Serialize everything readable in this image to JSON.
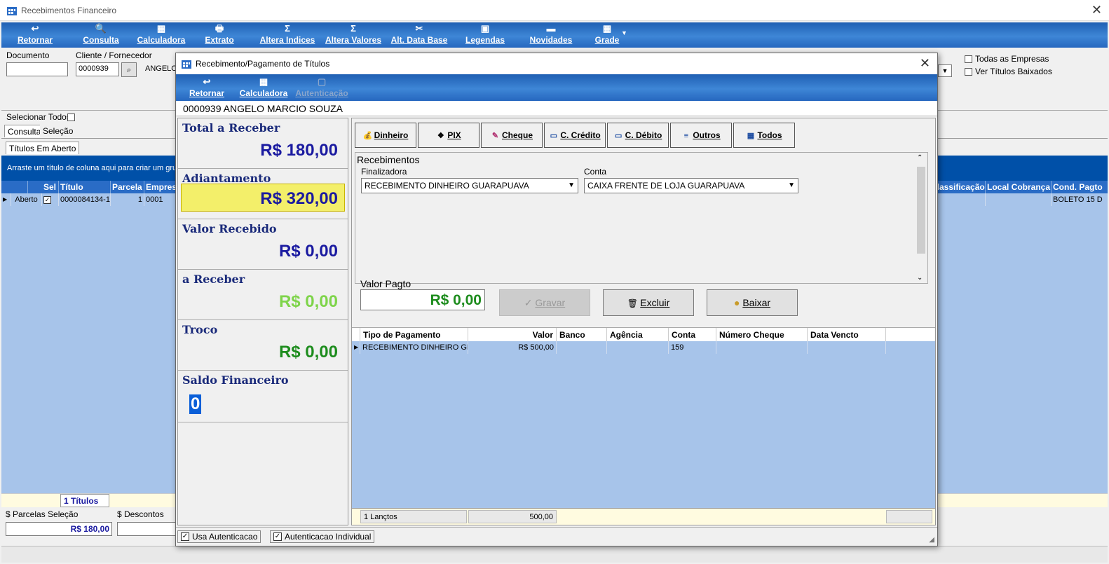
{
  "window": {
    "title": "Recebimentos Financeiro",
    "close_glyph": "✕"
  },
  "main_toolbar": [
    {
      "id": "retornar",
      "label": "Retornar",
      "icon": "return-icon",
      "glyph": "↩"
    },
    {
      "id": "consulta",
      "label": "Consulta",
      "icon": "search-icon",
      "glyph": "🔍"
    },
    {
      "id": "calculadora",
      "label": "Calculadora",
      "icon": "calculator-icon",
      "glyph": "▦"
    },
    {
      "id": "extrato",
      "label": "Extrato",
      "icon": "printer-icon",
      "glyph": "🖶"
    },
    {
      "id": "altera_indices",
      "label": "Altera Indices",
      "icon": "sigma-icon",
      "glyph": "Σ"
    },
    {
      "id": "altera_valores",
      "label": "Altera Valores",
      "icon": "sigma-icon",
      "glyph": "Σ"
    },
    {
      "id": "alt_data_base",
      "label": "Alt. Data Base",
      "icon": "tools-icon",
      "glyph": "✂"
    },
    {
      "id": "legendas",
      "label": "Legendas",
      "icon": "legend-icon",
      "glyph": "▣"
    },
    {
      "id": "novidades",
      "label": "Novidades",
      "icon": "news-icon",
      "glyph": "▬"
    },
    {
      "id": "grade",
      "label": "Grade",
      "icon": "grid-icon",
      "glyph": "▦"
    }
  ],
  "filter": {
    "documento_label": "Documento",
    "documento_value": "",
    "cliente_label": "Cliente / Fornecedor",
    "cliente_code": "0000939",
    "cliente_name": "ANGELO",
    "todas_empresas": "Todas as Empresas",
    "ver_baixados": "Ver Títulos Baixados",
    "selecionar_todos": "Selecionar Todos"
  },
  "tabs": {
    "consulta": "Consulta",
    "selecao": "Seleção",
    "titulos_aberto": "Títulos Em Aberto"
  },
  "group_hint": "Arraste um título de coluna aqui para criar um grupo",
  "main_grid": {
    "headers": [
      "Sel",
      "Título",
      "Parcela",
      "Empres",
      "Classificação",
      "Local Cobrança",
      "Cond. Pagto"
    ],
    "row": {
      "status": "Aberto",
      "titulo": "0000084134-1",
      "parcela": "1",
      "empresa": "0001",
      "cond": "BOLETO 15 D"
    },
    "footer_count": "1 Títulos"
  },
  "bottom": {
    "parcelas_label": "$ Parcelas Seleção",
    "parcelas_value": "R$ 180,00",
    "descontos_label": "$ Descontos"
  },
  "dialog": {
    "title": "Recebimento/Pagamento de Títulos",
    "close_glyph": "✕",
    "toolbar": [
      {
        "id": "retornar",
        "label": "Retornar",
        "glyph": "↩"
      },
      {
        "id": "calculadora",
        "label": "Calculadora",
        "glyph": "▦"
      },
      {
        "id": "autenticacao",
        "label": "Autenticação",
        "glyph": "▢"
      }
    ],
    "customer": "0000939 ANGELO MARCIO SOUZA",
    "summary": [
      {
        "id": "total",
        "label": "Total a Receber",
        "value": "R$ 180,00",
        "color": "#1a1aa0"
      },
      {
        "id": "adiantamento",
        "label": "Adiantamento",
        "value": "R$ 320,00",
        "color": "#1a1aa0"
      },
      {
        "id": "recebido",
        "label": "Valor Recebido",
        "value": "R$ 0,00",
        "color": "#1a1aa0"
      },
      {
        "id": "a_receber",
        "label": "a Receber",
        "value": "R$ 0,00",
        "color": "#7ed44a"
      },
      {
        "id": "troco",
        "label": "Troco",
        "value": "R$ 0,00",
        "color": "#1d8c1d"
      },
      {
        "id": "saldo",
        "label": "Saldo Financeiro",
        "value": "0",
        "color": "#ffffff"
      }
    ],
    "payment_types": [
      {
        "id": "dinheiro",
        "label": "Dinheiro",
        "glyph": "💰",
        "icon": "money-bag-icon"
      },
      {
        "id": "pix",
        "label": "PIX",
        "glyph": "❖",
        "icon": "pix-icon"
      },
      {
        "id": "cheque",
        "label": "Cheque",
        "glyph": "✎",
        "icon": "cheque-icon"
      },
      {
        "id": "credito",
        "label": "C. Crédito",
        "glyph": "▭",
        "icon": "credit-card-icon"
      },
      {
        "id": "debito",
        "label": "C. Débito",
        "glyph": "▭",
        "icon": "debit-card-icon"
      },
      {
        "id": "outros",
        "label": "Outros",
        "glyph": "≡",
        "icon": "list-icon"
      },
      {
        "id": "todos",
        "label": "Todos",
        "glyph": "▦",
        "icon": "table-icon"
      }
    ],
    "recebimentos": {
      "title": "Recebimentos",
      "finalizadora_label": "Finalizadora",
      "finalizadora_value": "RECEBIMENTO DINHEIRO GUARAPUAVA",
      "conta_label": "Conta",
      "conta_value": "CAIXA FRENTE DE LOJA GUARAPUAVA"
    },
    "valor_pagto_label": "Valor Pagto",
    "valor_pagto_value": "R$ 0,00",
    "actions": {
      "gravar": "Gravar",
      "excluir": "Excluir",
      "baixar": "Baixar"
    },
    "pay_grid": {
      "headers": [
        "Tipo de Pagamento",
        "Valor",
        "Banco",
        "Agência",
        "Conta",
        "Número Cheque",
        "Data Vencto"
      ],
      "row": {
        "tipo": "RECEBIMENTO DINHEIRO GL",
        "valor": "R$ 500,00",
        "banco": "",
        "agencia": "",
        "conta": "159",
        "numero": "",
        "data": ""
      },
      "footer_count": "1 Lançtos",
      "footer_total": "500,00"
    },
    "status": {
      "usa_autenticacao": "Usa Autenticacao",
      "autenticacao_individual": "Autenticacao Individual"
    }
  },
  "colors": {
    "toolbar_blue": "#2a6cc6",
    "grid_row": "#a7c4ea",
    "highlight_yellow": "#f3ef6a"
  }
}
